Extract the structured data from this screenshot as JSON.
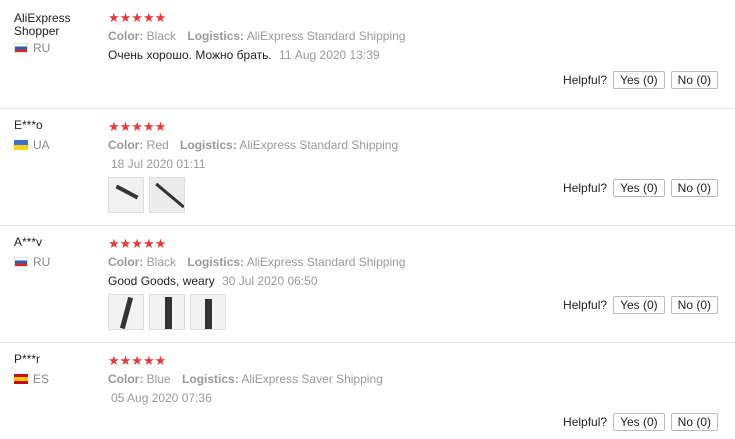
{
  "helpful_label": "Helpful?",
  "reviews": [
    {
      "user": "AliExpress Shopper",
      "country": "RU",
      "stars": "★★★★★",
      "color_label": "Color:",
      "color": "Black",
      "logistics_label": "Logistics:",
      "logistics": "AliExpress Standard Shipping",
      "text": "Очень хорошо. Можно брать.",
      "date": "11 Aug 2020 13:39",
      "yes": "Yes (0)",
      "no": "No (0)"
    },
    {
      "user": "E***o",
      "country": "UA",
      "stars": "★★★★★",
      "color_label": "Color:",
      "color": "Red",
      "logistics_label": "Logistics:",
      "logistics": "AliExpress Standard Shipping",
      "date": "18 Jul 2020 01:11",
      "yes": "Yes (0)",
      "no": "No (0)"
    },
    {
      "user": "A***v",
      "country": "RU",
      "stars": "★★★★★",
      "color_label": "Color:",
      "color": "Black",
      "logistics_label": "Logistics:",
      "logistics": "AliExpress Standard Shipping",
      "text": "Good Goods, weary",
      "date": "30 Jul 2020 06:50",
      "yes": "Yes (0)",
      "no": "No (0)"
    },
    {
      "user": "P***r",
      "country": "ES",
      "stars": "★★★★★",
      "color_label": "Color:",
      "color": "Blue",
      "logistics_label": "Logistics:",
      "logistics": "AliExpress Saver Shipping",
      "date": "05 Aug 2020 07:36",
      "yes": "Yes (0)",
      "no": "No (0)"
    }
  ]
}
